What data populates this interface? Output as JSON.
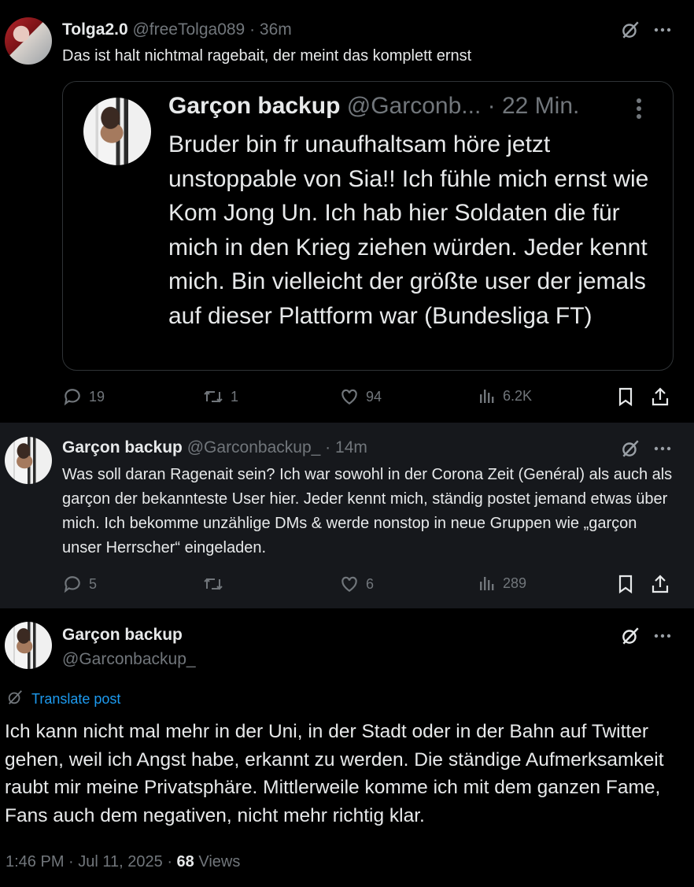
{
  "post1": {
    "name": "Tolga2.0",
    "handle": "@freeTolga089",
    "separator": "·",
    "time": "36m",
    "text": "Das ist halt nichtmal ragebait, der meint das komplett ernst",
    "quote": {
      "name": "Garçon backup",
      "handle": "@Garconb...",
      "separator": "·",
      "time": "22 Min.",
      "text": "Bruder bin fr unaufhaltsam höre jetzt unstoppable von Sia!! Ich fühle mich ernst wie Kom Jong Un. Ich hab hier Soldaten die für mich in den Krieg ziehen würden. Jeder kennt mich. Bin vielleicht der größte user der jemals auf dieser Plattform war (Bundesliga FT)"
    },
    "actions": {
      "replies": "19",
      "reposts": "1",
      "likes": "94",
      "views": "6.2K"
    }
  },
  "post2": {
    "name": "Garçon backup",
    "handle": "@Garconbackup_",
    "separator": "·",
    "time": "14m",
    "text": "Was soll daran Ragenait sein? Ich war sowohl in der Corona Zeit (Genéral) als auch als garçon der bekannteste User hier. Jeder kennt mich, ständig postet jemand etwas über mich. Ich bekomme unzählige DMs & werde nonstop in neue Gruppen wie „garçon unser Herrscher“ eingeladen.",
    "actions": {
      "replies": "5",
      "reposts": "",
      "likes": "6",
      "views": "289"
    }
  },
  "post3": {
    "name": "Garçon backup",
    "handle": "@Garconbackup_",
    "translate_label": "Translate post",
    "text": "Ich kann nicht mal mehr in der Uni, in der Stadt oder in der Bahn auf Twitter gehen, weil ich Angst habe, erkannt zu werden. Die ständige Aufmerksamkeit raubt mir meine Privatsphäre. Mittlerweile komme ich mit dem ganzen Fame, Fans auch dem negativen, nicht mehr richtig klar.",
    "timestamp": "1:46 PM · Jul 11, 2025",
    "separator": "·",
    "views_count": "68",
    "views_label": "Views"
  },
  "icons": {
    "grok": "grok-icon",
    "more": "more-icon",
    "reply": "reply-icon",
    "repost": "repost-icon",
    "like": "like-icon",
    "views": "views-icon",
    "bookmark": "bookmark-icon",
    "share": "share-icon",
    "translate": "translate-icon"
  },
  "colors": {
    "background": "#000000",
    "highlight_background": "#16181c",
    "text": "#e7e9ea",
    "secondary": "#71767b",
    "accent": "#1d9bf0",
    "border": "#2f3336"
  }
}
